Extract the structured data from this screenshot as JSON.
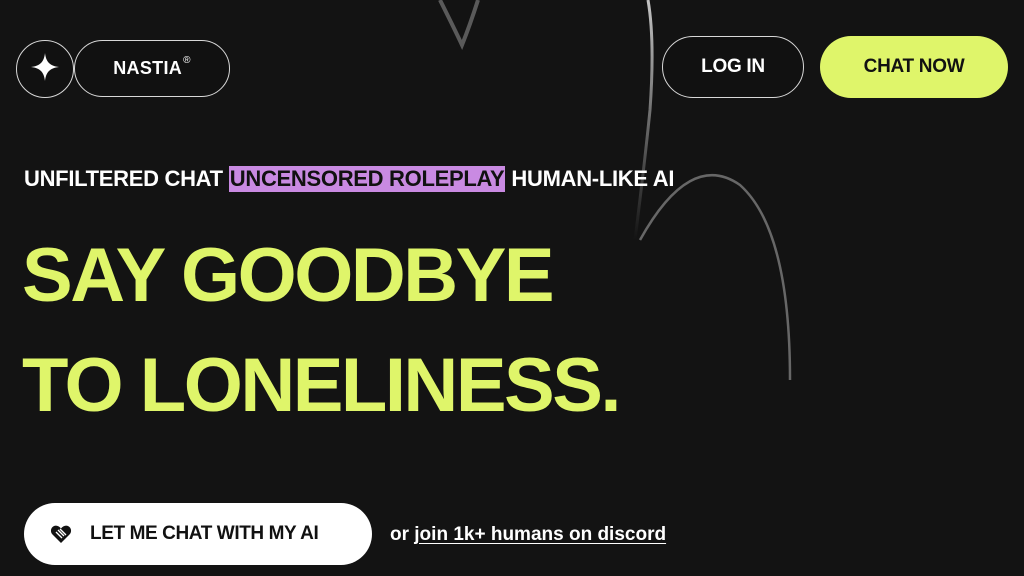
{
  "brand": {
    "name": "NASTIA",
    "registered_mark": "®"
  },
  "nav": {
    "login_label": "LOG IN",
    "chat_now_label": "CHAT NOW"
  },
  "tagline": {
    "part1": "UNFILTERED CHAT",
    "highlight": "UNCENSORED ROLEPLAY",
    "part2": "HUMAN-LIKE AI"
  },
  "hero": {
    "line1": "SAY GOODBYE",
    "line2": "TO LONELINESS."
  },
  "cta": {
    "button_label": "LET ME CHAT WITH MY AI",
    "or_text": "or",
    "discord_link": "join 1k+ humans on discord"
  },
  "icons": {
    "logo": "sparkle-icon",
    "cta": "heart-icon"
  },
  "colors": {
    "background": "#131313",
    "accent": "#dff56a",
    "highlight": "#c98ae2",
    "button_light": "#ffffff"
  }
}
